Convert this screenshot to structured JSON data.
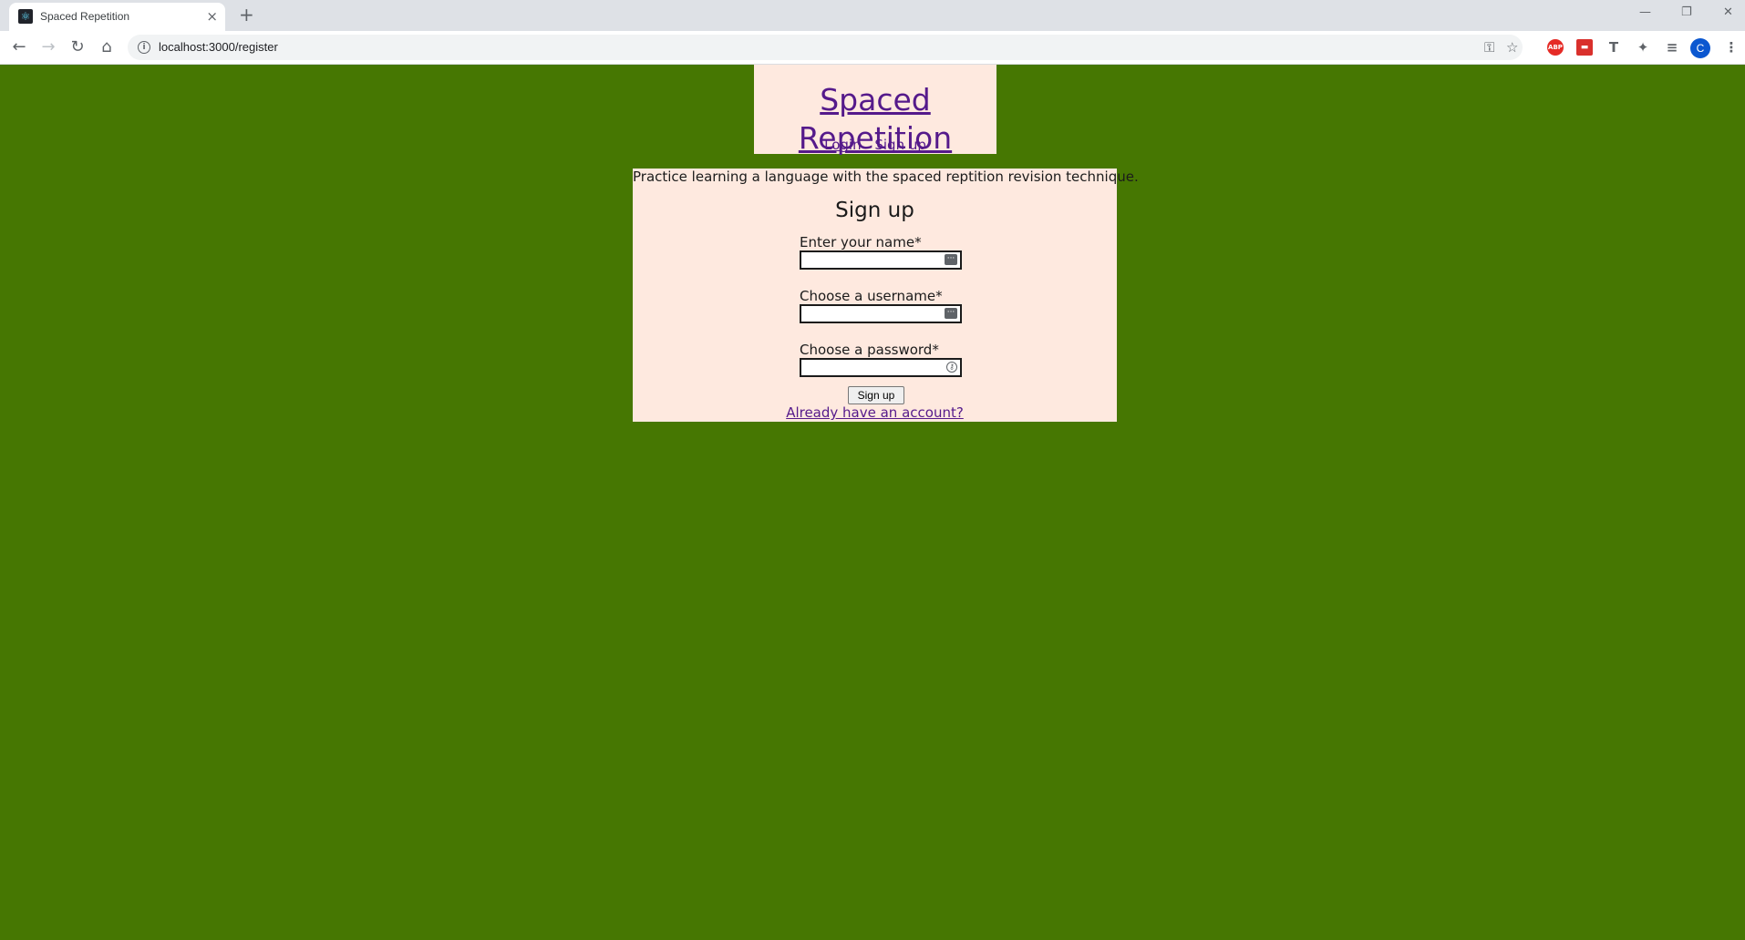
{
  "browser": {
    "tab_title": "Spaced Repetition",
    "tab_close": "×",
    "new_tab": "+",
    "url": "localhost:3000/register",
    "nav_icons": [
      "back-arrow-icon",
      "forward-arrow-icon",
      "reload-icon",
      "home-icon"
    ],
    "extensions": {
      "abp_label": "ABP",
      "avatar_letter": "C"
    }
  },
  "header": {
    "title": "Spaced Repetition",
    "nav": {
      "login": "Login",
      "signup": "Sign up"
    }
  },
  "main": {
    "intro": "Practice learning a language with the spaced reptition revision technique.",
    "form": {
      "title": "Sign up",
      "fields": [
        {
          "label": "Enter your name*",
          "value": ""
        },
        {
          "label": "Choose a username*",
          "value": ""
        },
        {
          "label": "Choose a password*",
          "value": ""
        }
      ],
      "submit_label": "Sign up",
      "login_link": "Already have an account?"
    }
  },
  "colors": {
    "page_background": "#467702",
    "panel_background": "#fee9df",
    "link": "#551a8b"
  }
}
